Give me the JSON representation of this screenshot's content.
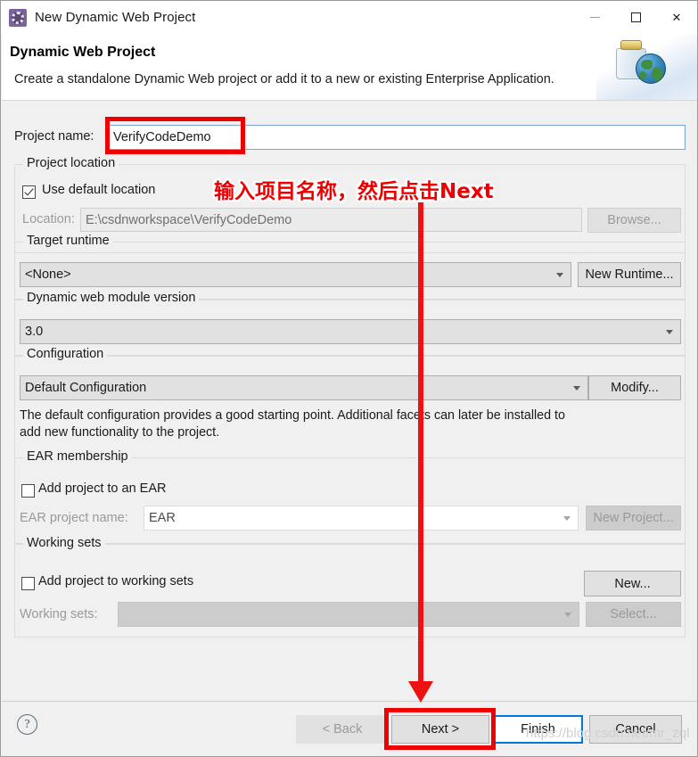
{
  "window": {
    "title": "New Dynamic Web Project",
    "icon": "eclipse-wizard-icon",
    "minimize_label": "—",
    "maximize_label": "□",
    "close_label": "✕"
  },
  "header": {
    "title": "Dynamic Web Project",
    "description": "Create a standalone Dynamic Web project or add it to a new or existing Enterprise Application.",
    "banner_icon": "web-project-jar-globe-icon"
  },
  "form": {
    "project_name": {
      "label": "Project name:",
      "value": "VerifyCodeDemo",
      "placeholder": ""
    },
    "project_location": {
      "group_title": "Project location",
      "use_default_label": "Use default location",
      "use_default_checked": true,
      "location_label": "Location:",
      "location_value": "E:\\csdnworkspace\\VerifyCodeDemo",
      "browse_label": "Browse..."
    },
    "target_runtime": {
      "group_title": "Target runtime",
      "value": "<None>",
      "options": [
        "<None>"
      ],
      "new_runtime_label": "New Runtime..."
    },
    "module_version": {
      "group_title": "Dynamic web module version",
      "value": "3.0",
      "options": [
        "3.0"
      ]
    },
    "configuration": {
      "group_title": "Configuration",
      "value": "Default Configuration",
      "options": [
        "Default Configuration"
      ],
      "modify_label": "Modify...",
      "description_line1": "The default configuration provides a good starting point. Additional facets can later be installed to",
      "description_line2": "add new functionality to the project."
    },
    "ear_membership": {
      "group_title": "EAR membership",
      "add_to_ear_label": "Add project to an EAR",
      "add_to_ear_checked": false,
      "ear_project_name_label": "EAR project name:",
      "ear_project_name_value": "EAR",
      "new_project_label": "New Project..."
    },
    "working_sets": {
      "group_title": "Working sets",
      "add_to_working_sets_label": "Add project to working sets",
      "add_to_working_sets_checked": false,
      "working_sets_label": "Working sets:",
      "working_sets_value": "",
      "new_label": "New...",
      "select_label": "Select..."
    }
  },
  "footer": {
    "help_label": "?",
    "back_label": "< Back",
    "next_label": "Next >",
    "finish_label": "Finish",
    "cancel_label": "Cancel"
  },
  "annotations": {
    "instruction": "输入项目名称，然后点击Next",
    "highlight_color": "#ee0000",
    "arrow_color": "#ee1111",
    "watermark": "https://blog.csdn.net/mr_zql"
  }
}
